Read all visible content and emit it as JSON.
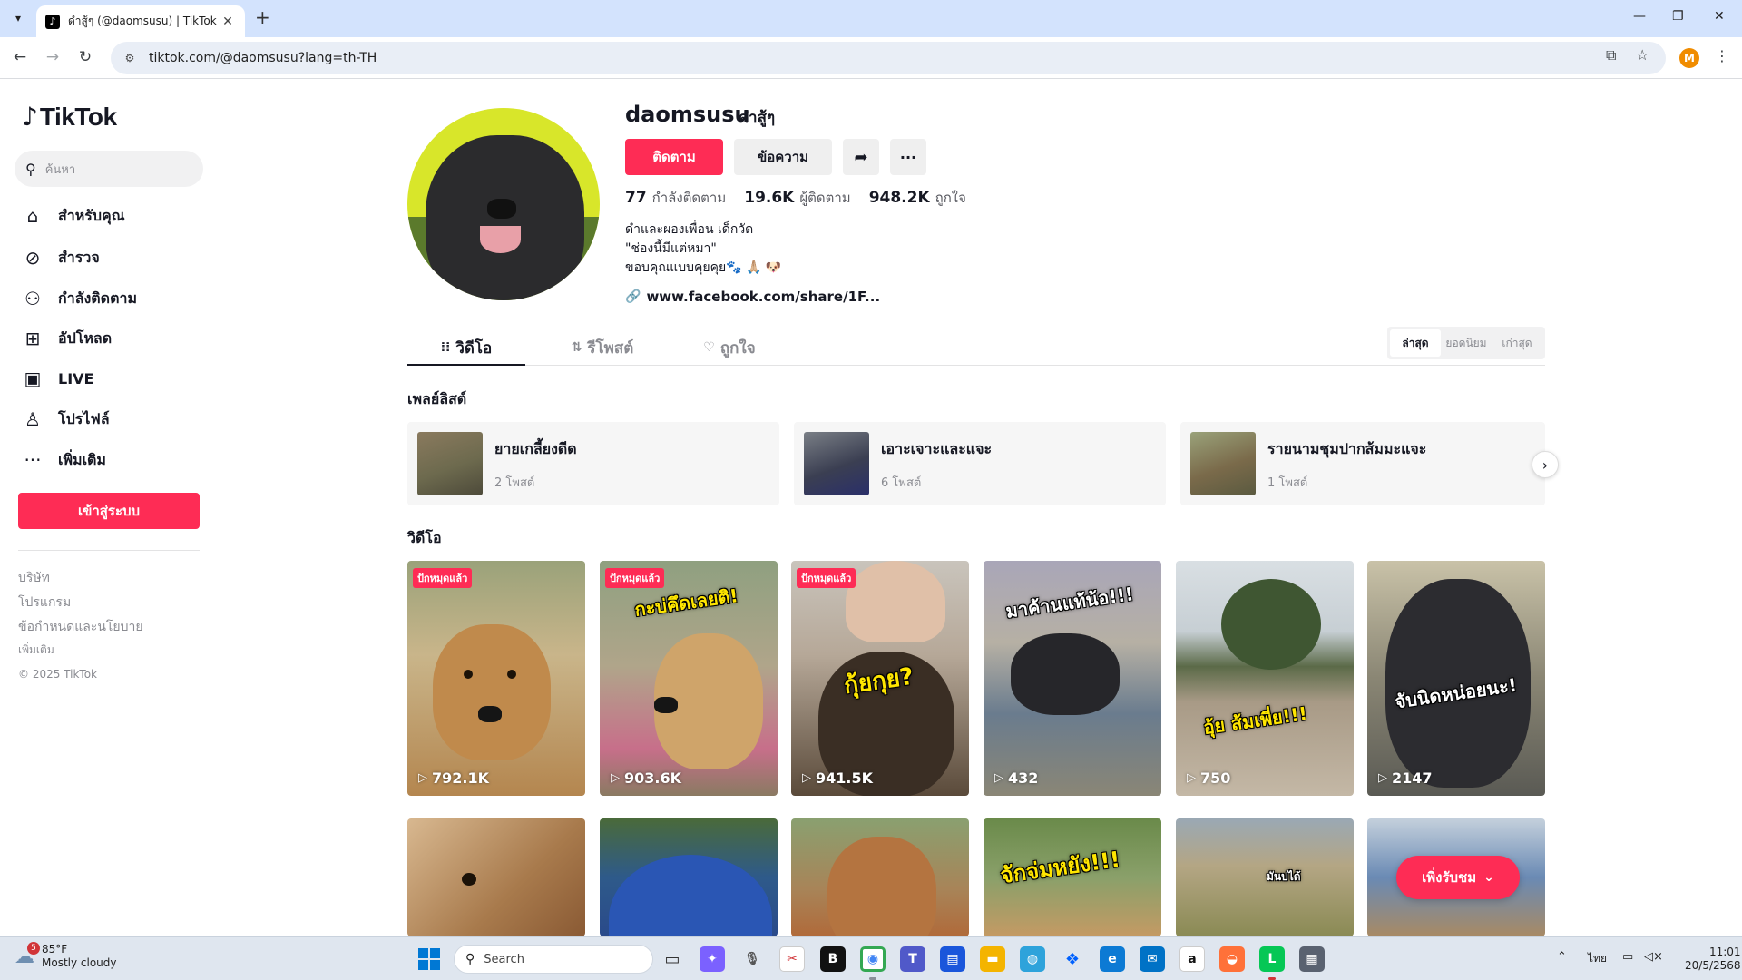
{
  "browser": {
    "tab_title": "ดำสู้ๆ (@daomsusu) | TikTok",
    "url": "tiktok.com/@daomsusu?lang=th-TH",
    "profile_initial": "M"
  },
  "sidebar": {
    "logo": "TikTok",
    "search_placeholder": "ค้นหา",
    "nav": [
      {
        "label": "สำหรับคุณ",
        "icon": "home-icon"
      },
      {
        "label": "สำรวจ",
        "icon": "compass-icon"
      },
      {
        "label": "กำลังติดตาม",
        "icon": "following-icon"
      },
      {
        "label": "อัปโหลด",
        "icon": "upload-icon"
      },
      {
        "label": "LIVE",
        "icon": "live-icon"
      },
      {
        "label": "โปรไฟล์",
        "icon": "profile-icon"
      },
      {
        "label": "เพิ่มเติม",
        "icon": "more-icon"
      }
    ],
    "login_label": "เข้าสู่ระบบ",
    "footer": {
      "company": "บริษัท",
      "program": "โปรแกรม",
      "terms": "ข้อกำหนดและนโยบาย",
      "more": "เพิ่มเติม",
      "copyright": "© 2025 TikTok"
    }
  },
  "profile": {
    "username": "daomsusu",
    "nickname": "ดำสู้ๆ",
    "follow_label": "ติดตาม",
    "message_label": "ข้อความ",
    "stats": {
      "following_count": "77",
      "following_label": "กำลังติดตาม",
      "followers_count": "19.6K",
      "followers_label": "ผู้ติดตาม",
      "likes_count": "948.2K",
      "likes_label": "ถูกใจ"
    },
    "bio": [
      "ดำและผองเพื่อน เด็กวัด",
      "\"ช่องนี้มีแต่หมา\"",
      "ขอบคุณแบบคุยคุย🐾 🙏🏼 🐶"
    ],
    "link": "www.facebook.com/share/1F..."
  },
  "tabs": {
    "videos": "วิดีโอ",
    "reposts": "รีโพสต์",
    "liked": "ถูกใจ",
    "sort": [
      "ล่าสุด",
      "ยอดนิยม",
      "เก่าสุด"
    ]
  },
  "playlists": {
    "title": "เพลย์ลิสต์",
    "items": [
      {
        "title": "ยายเกลี้ยงดีด",
        "count": "2 โพสต์"
      },
      {
        "title": "เอาะเจาะและแจะ",
        "count": "6 โพสต์"
      },
      {
        "title": "รายนามชุมปากส้มมะแจะ",
        "count": "1 โพสต์"
      }
    ]
  },
  "videos": {
    "title": "วิดีโอ",
    "pinned_label": "ปักหมุดแล้ว",
    "row1": [
      {
        "views": "792.1K",
        "overlay": ""
      },
      {
        "views": "903.6K",
        "overlay": "กะบ่คึดเลยติ!"
      },
      {
        "views": "941.5K",
        "overlay": "กุ้ยกุย?"
      },
      {
        "views": "432",
        "overlay": "มาค้านแท้น้อ!!!"
      },
      {
        "views": "750",
        "overlay": "อุ้ย ส้มเพี่ย!!!"
      },
      {
        "views": "2147",
        "overlay": "จับนิดหน่อยนะ!"
      }
    ],
    "row2_overlays": [
      "",
      "",
      "",
      "จักจ่มหยัง!!!",
      "มันบ่ได้",
      ""
    ],
    "watch_more_label": "เพิ่งรับชม"
  },
  "taskbar": {
    "weather_temp": "85°F",
    "weather_desc": "Mostly cloudy",
    "weather_badge": "5",
    "search_label": "Search",
    "lang": "ไทย",
    "time": "11:01",
    "date": "20/5/2568"
  },
  "colors": {
    "accent": "#fe2c55",
    "text": "#161823"
  }
}
